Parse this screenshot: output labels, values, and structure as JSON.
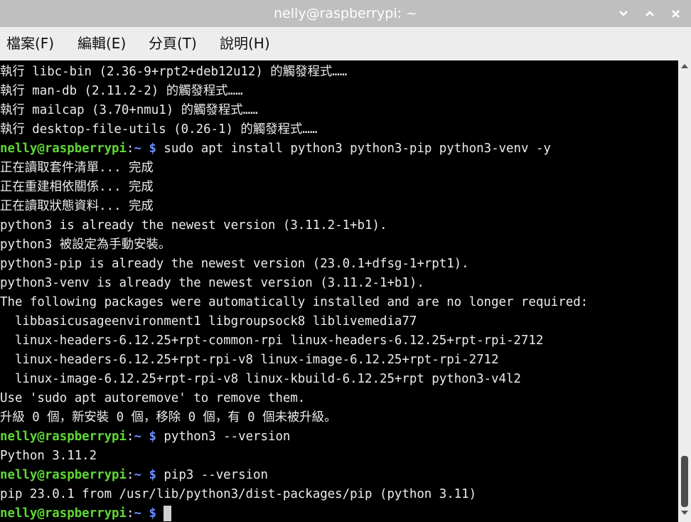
{
  "window": {
    "title": "nelly@raspberrypi: ~",
    "controls": {
      "minimize_icon": "chevron-down-icon",
      "maximize_icon": "chevron-up-icon",
      "close_icon": "close-icon"
    }
  },
  "menu": {
    "file": "檔案(F)",
    "edit": "編輯(E)",
    "tabs": "分頁(T)",
    "help": "說明(H)"
  },
  "terminal": {
    "prompt": {
      "user_host": "nelly@raspberrypi",
      "colon": ":",
      "path": "~",
      "dollar": "$"
    },
    "lines": [
      {
        "text": "執行 libc-bin (2.36-9+rpt2+deb12u12) 的觸發程式……"
      },
      {
        "text": "執行 man-db (2.11.2-2) 的觸發程式……"
      },
      {
        "text": "執行 mailcap (3.70+nmu1) 的觸發程式……"
      },
      {
        "text": "執行 desktop-file-utils (0.26-1) 的觸發程式……"
      },
      {
        "prompt": true,
        "command": " sudo apt install python3 python3-pip python3-venv -y"
      },
      {
        "text": "正在讀取套件清單... 完成"
      },
      {
        "text": "正在重建相依關係... 完成"
      },
      {
        "text": "正在讀取狀態資料... 完成"
      },
      {
        "text": "python3 is already the newest version (3.11.2-1+b1)."
      },
      {
        "text": "python3 被設定為手動安裝。"
      },
      {
        "text": "python3-pip is already the newest version (23.0.1+dfsg-1+rpt1)."
      },
      {
        "text": "python3-venv is already the newest version (3.11.2-1+b1)."
      },
      {
        "text": "The following packages were automatically installed and are no longer required:"
      },
      {
        "text": "  libbasicusageenvironment1 libgroupsock8 liblivemedia77"
      },
      {
        "text": "  linux-headers-6.12.25+rpt-common-rpi linux-headers-6.12.25+rpt-rpi-2712"
      },
      {
        "text": "  linux-headers-6.12.25+rpt-rpi-v8 linux-image-6.12.25+rpt-rpi-2712"
      },
      {
        "text": "  linux-image-6.12.25+rpt-rpi-v8 linux-kbuild-6.12.25+rpt python3-v4l2"
      },
      {
        "text": "Use 'sudo apt autoremove' to remove them."
      },
      {
        "text": "升級 0 個，新安裝 0 個，移除 0 個，有 0 個未被升級。"
      },
      {
        "prompt": true,
        "command": " python3 --version"
      },
      {
        "text": "Python 3.11.2"
      },
      {
        "prompt": true,
        "command": " pip3 --version"
      },
      {
        "text": "pip 23.0.1 from /usr/lib/python3/dist-packages/pip (python 3.11)"
      },
      {
        "prompt": true,
        "command": " ",
        "cursor": true
      }
    ]
  },
  "scrollbar": {
    "position": 0.97,
    "visible_fraction": 0.12
  }
}
